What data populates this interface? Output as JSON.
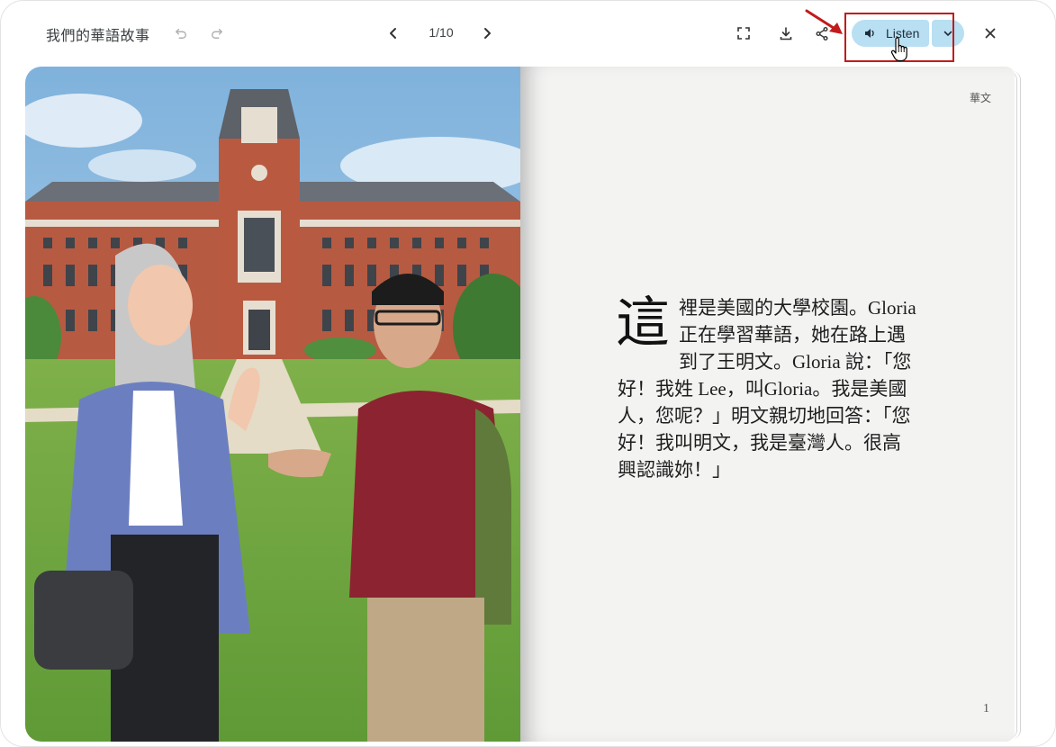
{
  "app": {
    "title": "我們的華語故事"
  },
  "toolbar": {
    "undo_icon": "undo-icon",
    "redo_icon": "redo-icon",
    "page_indicator": "1/10",
    "fullscreen_icon": "fullscreen-icon",
    "download_icon": "download-icon",
    "share_icon": "share-icon",
    "listen_label": "Listen",
    "close_icon": "close-icon"
  },
  "colors": {
    "listen_bg": "#b8dff2",
    "highlight": "#c21b1b"
  },
  "book": {
    "illustration": "Two people talking in front of a red-brick university building",
    "language_tag": "華文",
    "dropcap": "這",
    "story_text": "裡是美國的大學校園。Gloria 正在學習華語，她在路上遇到了王明文。Gloria 說：「您好！我姓 Lee，叫Gloria。我是美國人，您呢？」明文親切地回答：「您好！我叫明文，我是臺灣人。很高興認識妳！」",
    "page_number": "1"
  }
}
